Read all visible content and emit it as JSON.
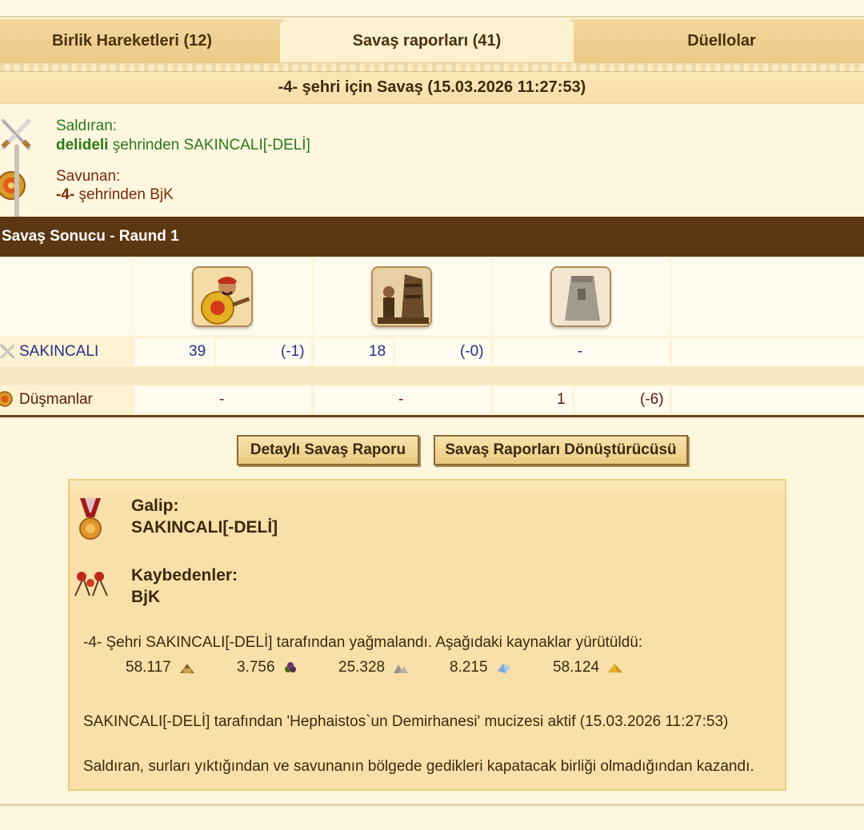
{
  "tabs": [
    {
      "label": "Birlik Hareketleri (12)"
    },
    {
      "label": "Savaş raporları (41)"
    },
    {
      "label": "Düellolar"
    }
  ],
  "report_title": "-4- şehri için Savaş (15.03.2026 11:27:53)",
  "attacker": {
    "heading": "Saldıran:",
    "player": "delideli",
    "city_text": "şehrinden SAKINCALI[-DELİ]"
  },
  "defender": {
    "heading": "Savunan:",
    "player": "-4-",
    "city_text": "şehrinden BjK"
  },
  "result_heading": "Savaş Sonucu - Raund 1",
  "units": [
    "hoplite-unit",
    "siege-unit",
    "wall-unit"
  ],
  "rows": {
    "own": {
      "name": "SAKINCALI",
      "u1_count": "39",
      "u1_loss": "(-1)",
      "u2_count": "18",
      "u2_loss": "(-0)",
      "u3_count": "-"
    },
    "enemy": {
      "name": "Düşmanlar",
      "u1_count": "-",
      "u2_count": "-",
      "u3_count": "1",
      "u3_loss": "(-6)"
    }
  },
  "buttons": {
    "detailed": "Detaylı Savaş Raporu",
    "converter": "Savaş Raporları Dönüştürücüsü"
  },
  "summary": {
    "winner_label": "Galip:",
    "winner": "SAKINCALI[-DELİ]",
    "losers_label": "Kaybedenler:",
    "losers": "BjK",
    "pillage_text": "-4- Şehri SAKINCALI[-DELİ] tarafından yağmalandı. Aşağıdaki kaynaklar yürütüldü:",
    "resources": [
      {
        "amount": "58.117",
        "icon": "wood-icon"
      },
      {
        "amount": "3.756",
        "icon": "wine-icon"
      },
      {
        "amount": "25.328",
        "icon": "marble-icon"
      },
      {
        "amount": "8.215",
        "icon": "crystal-icon"
      },
      {
        "amount": "58.124",
        "icon": "sulfur-icon"
      }
    ],
    "wonder_text": "SAKINCALI[-DELİ] tarafından 'Hephaistos`un Demirhanesi' mucizesi aktif (15.03.2026 11:27:53)",
    "reason_text": "Saldıran, surları yıktığından ve savunanın bölgede gedikleri kapatacak birliği olmadığından kazandı."
  },
  "colors": {
    "accent_bar": "#5b3712",
    "attacker_green": "#2a7a1a",
    "defender_red": "#7a2a0a",
    "link_blue": "#22308a"
  }
}
